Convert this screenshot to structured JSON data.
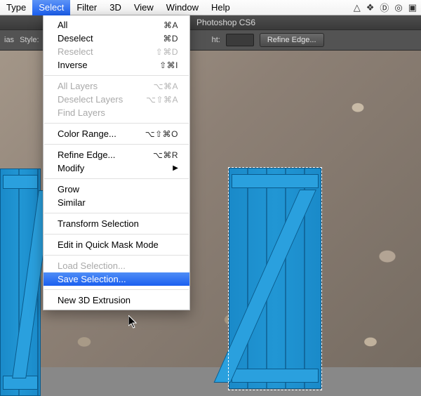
{
  "menubar": {
    "items": [
      "Type",
      "Select",
      "Filter",
      "3D",
      "View",
      "Window",
      "Help"
    ],
    "active_index": 1,
    "tray_icons": [
      "gdrive-icon",
      "dropbox-icon",
      "behance-icon",
      "cc-icon",
      "app-icon"
    ]
  },
  "ps_title": "Photoshop CS6",
  "options_bar": {
    "left_label": "ias",
    "style_label": "Style:",
    "style_value": "",
    "mid_label": "ht:",
    "refine_edge_btn": "Refine Edge..."
  },
  "menu": {
    "groups": [
      [
        {
          "label": "All",
          "shortcut": "⌘A",
          "disabled": false
        },
        {
          "label": "Deselect",
          "shortcut": "⌘D",
          "disabled": false
        },
        {
          "label": "Reselect",
          "shortcut": "⇧⌘D",
          "disabled": true
        },
        {
          "label": "Inverse",
          "shortcut": "⇧⌘I",
          "disabled": false
        }
      ],
      [
        {
          "label": "All Layers",
          "shortcut": "⌥⌘A",
          "disabled": true
        },
        {
          "label": "Deselect Layers",
          "shortcut": "⌥⇧⌘A",
          "disabled": true
        },
        {
          "label": "Find Layers",
          "shortcut": "",
          "disabled": true
        }
      ],
      [
        {
          "label": "Color Range...",
          "shortcut": "⌥⇧⌘O",
          "disabled": false
        }
      ],
      [
        {
          "label": "Refine Edge...",
          "shortcut": "⌥⌘R",
          "disabled": false
        },
        {
          "label": "Modify",
          "shortcut": "",
          "disabled": false,
          "submenu": true
        }
      ],
      [
        {
          "label": "Grow",
          "shortcut": "",
          "disabled": false
        },
        {
          "label": "Similar",
          "shortcut": "",
          "disabled": false
        }
      ],
      [
        {
          "label": "Transform Selection",
          "shortcut": "",
          "disabled": false
        }
      ],
      [
        {
          "label": "Edit in Quick Mask Mode",
          "shortcut": "",
          "disabled": false
        }
      ],
      [
        {
          "label": "Load Selection...",
          "shortcut": "",
          "disabled": true
        },
        {
          "label": "Save Selection...",
          "shortcut": "",
          "disabled": false,
          "highlight": true
        }
      ],
      [
        {
          "label": "New 3D Extrusion",
          "shortcut": "",
          "disabled": false
        }
      ]
    ]
  }
}
